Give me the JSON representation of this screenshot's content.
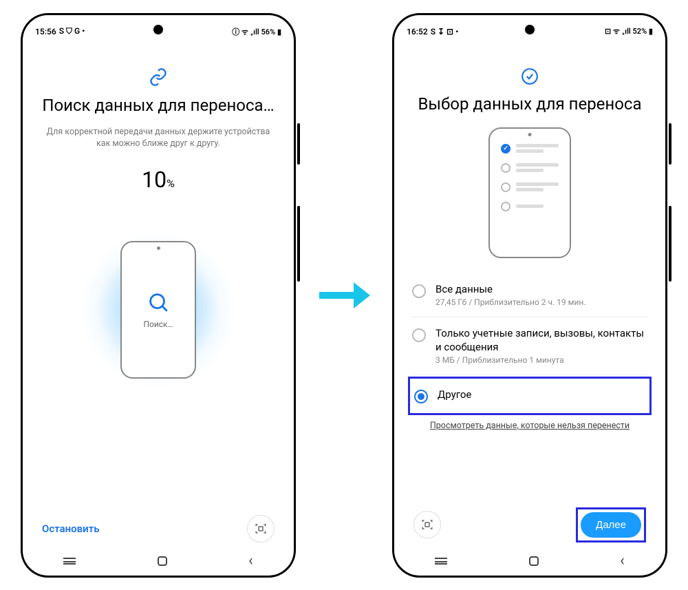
{
  "phone1": {
    "status": {
      "time": "15:56",
      "indicators": "S ⛉ G •",
      "right": "ⓘ ᯤ ₊ıll 56% ▮"
    },
    "title": "Поиск данных для переноса…",
    "subtitle": "Для корректной передачи данных держите устройства как можно ближе друг к другу.",
    "progress_value": "10",
    "progress_pct": "%",
    "searching_label": "Поиск…",
    "stop": "Остановить"
  },
  "phone2": {
    "status": {
      "time": "16:52",
      "indicators": "S ↧ ⊡ •",
      "right": "⊡ ᯤ ₊ıll 52% ▮"
    },
    "title": "Выбор данных для переноса",
    "options": [
      {
        "label": "Все данные",
        "meta": "27,45 Гб / Приблизительно 2 ч. 19 мин."
      },
      {
        "label": "Только учетные записи, вызовы, контакты и сообщения",
        "meta": "3 МБ / Приблизительно 1 минута"
      },
      {
        "label": "Другое",
        "meta": ""
      }
    ],
    "link": "Просмотреть данные, которые нельзя перенести",
    "next": "Далее"
  }
}
